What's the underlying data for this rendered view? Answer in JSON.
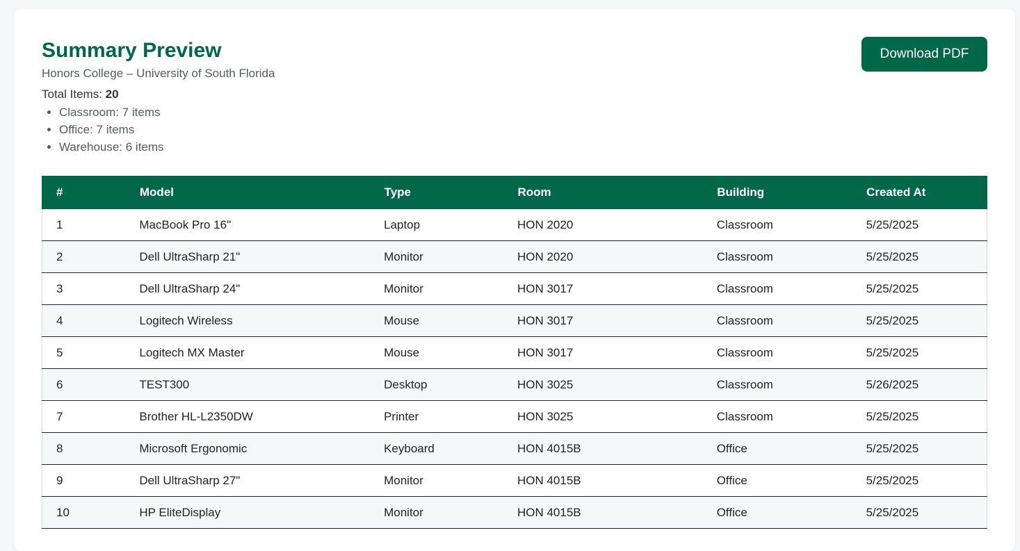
{
  "header": {
    "title": "Summary Preview",
    "subtitle": "Honors College – University of South Florida",
    "total_label": "Total Items:",
    "total_value": "20",
    "breakdown": [
      "Classroom: 7 items",
      "Office: 7 items",
      "Warehouse: 6 items"
    ],
    "download_label": "Download PDF"
  },
  "table": {
    "columns": [
      "#",
      "Model",
      "Type",
      "Room",
      "Building",
      "Created At"
    ],
    "rows": [
      [
        "1",
        "MacBook Pro 16\"",
        "Laptop",
        "HON 2020",
        "Classroom",
        "5/25/2025"
      ],
      [
        "2",
        "Dell UltraSharp 21\"",
        "Monitor",
        "HON 2020",
        "Classroom",
        "5/25/2025"
      ],
      [
        "3",
        "Dell UltraSharp 24\"",
        "Monitor",
        "HON 3017",
        "Classroom",
        "5/25/2025"
      ],
      [
        "4",
        "Logitech Wireless",
        "Mouse",
        "HON 3017",
        "Classroom",
        "5/25/2025"
      ],
      [
        "5",
        "Logitech MX Master",
        "Mouse",
        "HON 3017",
        "Classroom",
        "5/25/2025"
      ],
      [
        "6",
        "TEST300",
        "Desktop",
        "HON 3025",
        "Classroom",
        "5/26/2025"
      ],
      [
        "7",
        "Brother HL-L2350DW",
        "Printer",
        "HON 3025",
        "Classroom",
        "5/25/2025"
      ],
      [
        "8",
        "Microsoft Ergonomic",
        "Keyboard",
        "HON 4015B",
        "Office",
        "5/25/2025"
      ],
      [
        "9",
        "Dell UltraSharp 27\"",
        "Monitor",
        "HON 4015B",
        "Office",
        "5/25/2025"
      ],
      [
        "10",
        "HP EliteDisplay",
        "Monitor",
        "HON 4015B",
        "Office",
        "5/25/2025"
      ]
    ]
  },
  "colors": {
    "brand": "#006747",
    "row_alt": "#f6f7f9"
  }
}
